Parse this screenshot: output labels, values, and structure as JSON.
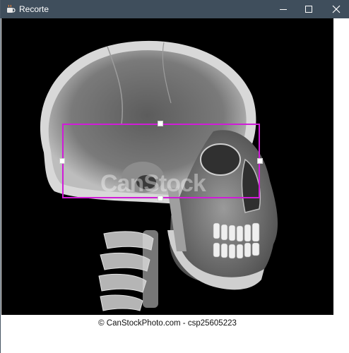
{
  "window": {
    "title": "Recorte",
    "app_icon": "java-cup-icon",
    "controls": [
      "minimize-icon",
      "maximize-icon",
      "close-icon"
    ]
  },
  "image": {
    "subject_icon": "skull-xray-image",
    "watermark_text": "CanStock",
    "caption": "© CanStockPhoto.com - csp25605223"
  },
  "selection": {
    "border_color": "#d01cd8",
    "handle_color": "#ffffff"
  },
  "colors": {
    "titlebar": "#3f4e5c",
    "image_background": "#000000"
  }
}
